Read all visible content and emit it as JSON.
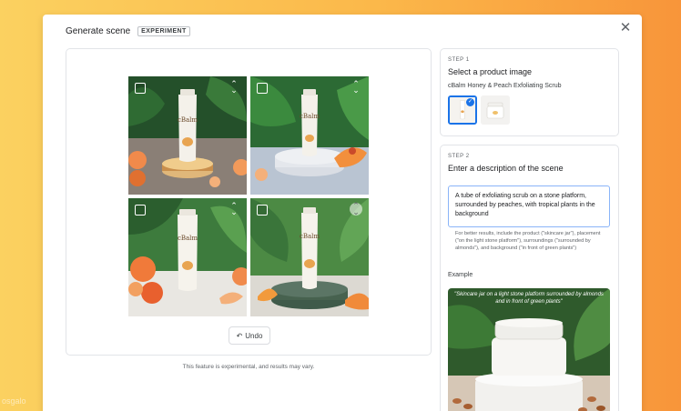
{
  "background_watermark": "osgalo",
  "modal": {
    "title": "Generate scene",
    "badge": "EXPERIMENT",
    "close_icon": "close-icon"
  },
  "results": {
    "tiles": [
      {
        "label": "cBalm",
        "selected": false,
        "expand_icon": "unfold-icon"
      },
      {
        "label": "cBalm",
        "selected": false,
        "expand_icon": "unfold-icon"
      },
      {
        "label": "cBalm",
        "selected": false,
        "expand_icon": "unfold-icon"
      },
      {
        "label": "cBalm",
        "selected": false,
        "expand_icon": "unfold-icon"
      }
    ],
    "undo_label": "Undo",
    "undo_icon": "undo-icon"
  },
  "disclaimer": "This feature is experimental, and results may vary.",
  "step1": {
    "label": "STEP 1",
    "title": "Select a product image",
    "product": "cBalm Honey & Peach Exfoliating Scrub",
    "thumbnails": [
      {
        "name": "tube-thumbnail",
        "selected": true
      },
      {
        "name": "jar-thumbnail",
        "selected": false
      }
    ]
  },
  "step2": {
    "label": "STEP 2",
    "title": "Enter a description of the scene",
    "description_value": "A tube of exfoliating scrub on a stone platform, surrounded by peaches, with tropical plants in the background",
    "help_text": "For better results, include the product (\"skincare jar\"), placement (\"on the light stone platform\"), surroundings (\"surrounded by almonds\"), and background (\"in front of green plants\")",
    "example_label": "Example",
    "example_caption": "\"Skincare jar on a light stone platform surrounded by almonds and in front of green plants\""
  },
  "colors": {
    "accent": "#1a73e8",
    "background_start": "#fbd160",
    "background_end": "#f8953a"
  }
}
